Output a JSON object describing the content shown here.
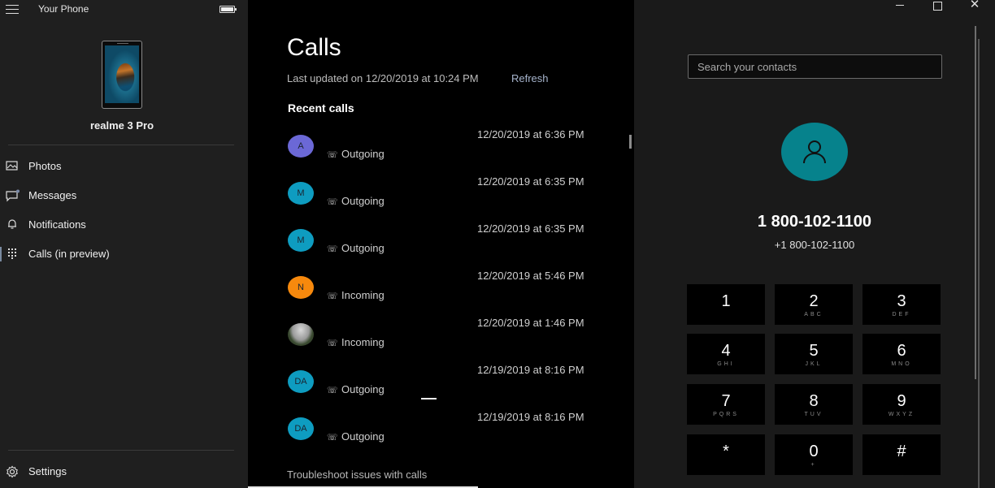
{
  "app": {
    "title": "Your Phone"
  },
  "device": {
    "name": "realme 3 Pro"
  },
  "sidebar": {
    "items": [
      {
        "label": "Photos",
        "icon": "photos-icon",
        "active": false
      },
      {
        "label": "Messages",
        "icon": "messages-icon",
        "active": false
      },
      {
        "label": "Notifications",
        "icon": "bell-icon",
        "active": false
      },
      {
        "label": "Calls (in preview)",
        "icon": "dialpad-icon",
        "active": true
      }
    ],
    "settings_label": "Settings"
  },
  "calls": {
    "title": "Calls",
    "last_updated": "Last updated on 12/20/2019 at 10:24 PM",
    "refresh_label": "Refresh",
    "recent_heading": "Recent calls",
    "items": [
      {
        "initials": "A",
        "color": "#6b68d6",
        "type": "Outgoing",
        "time": "12/20/2019 at 6:36 PM"
      },
      {
        "initials": "M",
        "color": "#0e9cc0",
        "type": "Outgoing",
        "time": "12/20/2019 at 6:35 PM"
      },
      {
        "initials": "M",
        "color": "#0e9cc0",
        "type": "Outgoing",
        "time": "12/20/2019 at 6:35 PM"
      },
      {
        "initials": "N",
        "color": "#f7890d",
        "type": "Incoming",
        "time": "12/20/2019 at 5:46 PM"
      },
      {
        "initials": "",
        "color": "photo",
        "type": "Incoming",
        "time": "12/20/2019 at 1:46 PM"
      },
      {
        "initials": "DA",
        "color": "#0e9cc0",
        "type": "Outgoing",
        "time": "12/19/2019 at 8:16 PM"
      },
      {
        "initials": "DA",
        "color": "#0e9cc0",
        "type": "Outgoing",
        "time": "12/19/2019 at 8:16 PM"
      }
    ],
    "troubleshoot_label": "Troubleshoot issues with calls"
  },
  "dialer": {
    "search_placeholder": "Search your contacts",
    "number_display": "1 800-102-1100",
    "number_formatted": "+1 800-102-1100",
    "accent": "#06828c",
    "keys": [
      {
        "digit": "1",
        "letters": ""
      },
      {
        "digit": "2",
        "letters": "ABC"
      },
      {
        "digit": "3",
        "letters": "DEF"
      },
      {
        "digit": "4",
        "letters": "GHI"
      },
      {
        "digit": "5",
        "letters": "JKL"
      },
      {
        "digit": "6",
        "letters": "MNO"
      },
      {
        "digit": "7",
        "letters": "PQRS"
      },
      {
        "digit": "8",
        "letters": "TUV"
      },
      {
        "digit": "9",
        "letters": "WXYZ"
      },
      {
        "digit": "*",
        "letters": ""
      },
      {
        "digit": "0",
        "letters": "+"
      },
      {
        "digit": "#",
        "letters": ""
      }
    ]
  }
}
